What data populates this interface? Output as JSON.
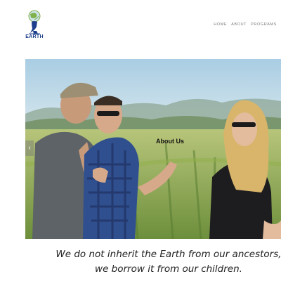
{
  "header": {
    "logo_text": "EARTH",
    "nav": [
      {
        "label": "HOME"
      },
      {
        "label": "ABOUT"
      },
      {
        "label": "PROGRAMS"
      }
    ]
  },
  "hero": {
    "title": "About Us",
    "arrow_left": "‹"
  },
  "quote": {
    "text": "We do not inherit the Earth from our ancestors, we borrow it from our children."
  },
  "colors": {
    "logo_blue": "#1d3f8c",
    "logo_green": "#7fb24a",
    "nav_gray": "#7b7b7b"
  }
}
